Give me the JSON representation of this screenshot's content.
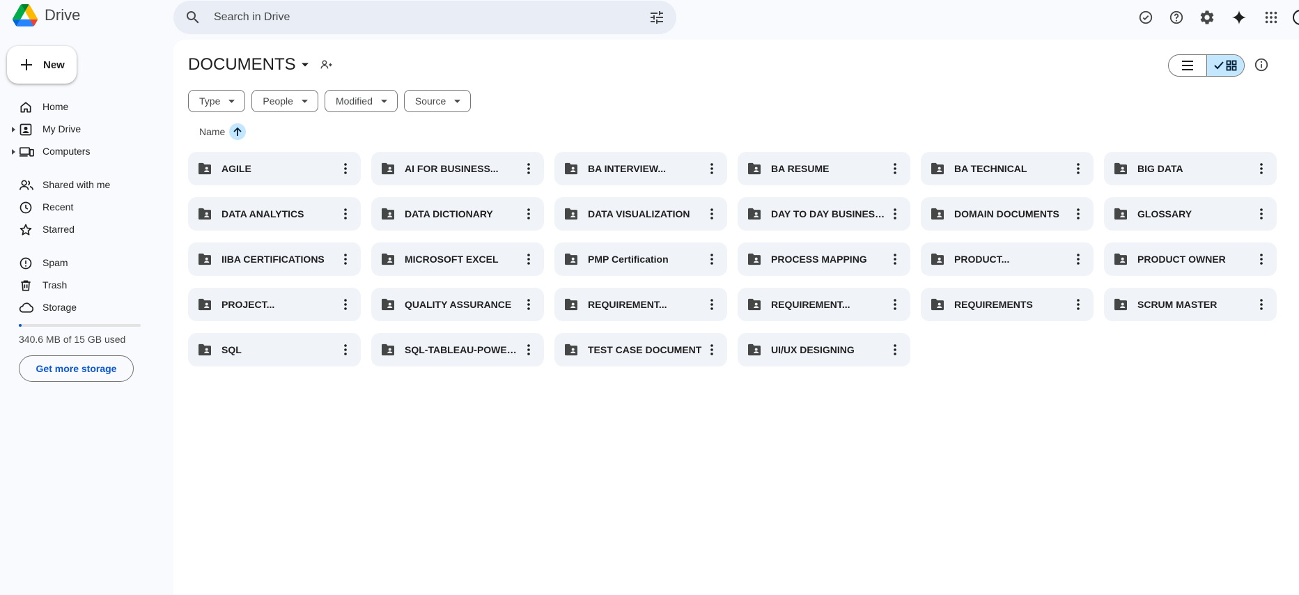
{
  "app": {
    "name": "Drive",
    "colors": {
      "accent": "#0b57d0",
      "selected": "#c2e7ff",
      "folder_bg": "#f0f4f9",
      "search_bg": "#e9eef6"
    }
  },
  "search": {
    "placeholder": "Search in Drive",
    "value": ""
  },
  "top_icons": [
    "ready-for-offline-icon",
    "help-icon",
    "settings-icon",
    "gemini-sparkle-icon",
    "apps-grid-icon"
  ],
  "sidebar": {
    "new_label": "New",
    "items": [
      {
        "label": "Home",
        "icon": "home-icon"
      },
      {
        "label": "My Drive",
        "icon": "my-drive-icon"
      },
      {
        "label": "Computers",
        "icon": "computers-icon"
      },
      {
        "label": "Shared with me",
        "icon": "shared-icon"
      },
      {
        "label": "Recent",
        "icon": "clock-icon"
      },
      {
        "label": "Starred",
        "icon": "star-icon"
      },
      {
        "label": "Spam",
        "icon": "spam-icon"
      },
      {
        "label": "Trash",
        "icon": "trash-icon"
      },
      {
        "label": "Storage",
        "icon": "cloud-icon"
      }
    ],
    "storage_used_fraction": 0.023,
    "storage_text": "340.6 MB of 15 GB used",
    "get_storage_label": "Get more storage"
  },
  "main": {
    "title": "DOCUMENTS",
    "view_mode": "grid",
    "filters": [
      "Type",
      "People",
      "Modified",
      "Source"
    ],
    "sort_label": "Name",
    "sort_direction": "ascending",
    "folders": [
      "AGILE",
      "AI FOR BUSINESS...",
      "BA INTERVIEW...",
      "BA RESUME",
      "BA TECHNICAL",
      "BIG DATA",
      "DATA ANALYTICS",
      "DATA DICTIONARY",
      "DATA VISUALIZATION",
      "DAY TO DAY BUSINESS...",
      "DOMAIN DOCUMENTS",
      "GLOSSARY",
      "IIBA CERTIFICATIONS",
      "MICROSOFT EXCEL",
      "PMP Certification",
      "PROCESS MAPPING",
      "PRODUCT...",
      "PRODUCT OWNER",
      "PROJECT...",
      "QUALITY ASSURANCE",
      "REQUIREMENT...",
      "REQUIREMENT...",
      "REQUIREMENTS",
      "SCRUM MASTER",
      "SQL",
      "SQL-TABLEAU-POWER...",
      "TEST CASE DOCUMENT",
      "UI/UX DESIGNING"
    ]
  }
}
